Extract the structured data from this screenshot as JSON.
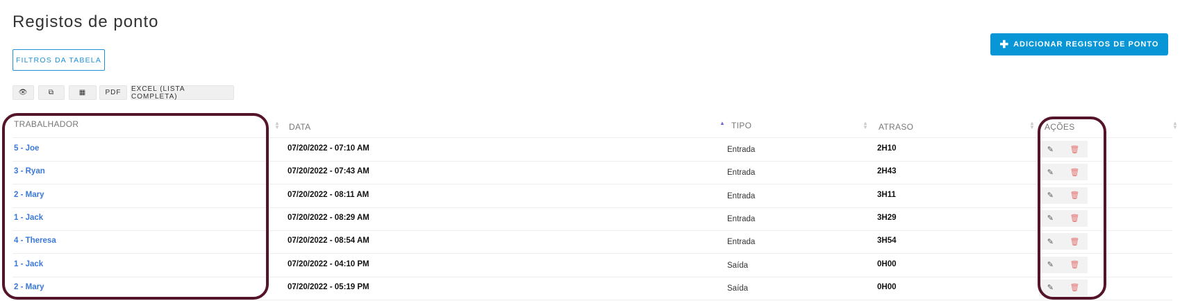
{
  "page_title": "Registos de ponto",
  "add_button": {
    "icon": "plus-icon",
    "label": "ADICIONAR REGISTOS DE PONTO"
  },
  "filter_button": "FILTROS DA TABELA",
  "toolbar": {
    "view_icon": "eye-icon",
    "copy_icon": "copy-icon",
    "csv_icon": "table-icon",
    "pdf": "PDF",
    "excel": "EXCEL (LISTA COMPLETA)"
  },
  "columns": [
    "TRABALHADOR",
    "DATA",
    "TIPO",
    "ATRASO",
    "AÇÕES"
  ],
  "sort": {
    "column": "TIPO",
    "direction": "asc"
  },
  "rows": [
    {
      "worker": "5 - Joe",
      "date": "07/20/2022 - 07:10 AM",
      "type": "Entrada",
      "delay": "2H10"
    },
    {
      "worker": "3 - Ryan",
      "date": "07/20/2022 - 07:43 AM",
      "type": "Entrada",
      "delay": "2H43"
    },
    {
      "worker": "2 - Mary",
      "date": "07/20/2022 - 08:11 AM",
      "type": "Entrada",
      "delay": "3H11"
    },
    {
      "worker": "1 - Jack",
      "date": "07/20/2022 - 08:29 AM",
      "type": "Entrada",
      "delay": "3H29"
    },
    {
      "worker": "4 - Theresa",
      "date": "07/20/2022 - 08:54 AM",
      "type": "Entrada",
      "delay": "3H54"
    },
    {
      "worker": "1 - Jack",
      "date": "07/20/2022 - 04:10 PM",
      "type": "Saída",
      "delay": "0H00"
    },
    {
      "worker": "2 - Mary",
      "date": "07/20/2022 - 05:19 PM",
      "type": "Saída",
      "delay": "0H00"
    }
  ],
  "colors": {
    "accent": "#0996d6",
    "link": "#3a78d8",
    "highlight": "#54142a",
    "delete": "#e57373"
  }
}
